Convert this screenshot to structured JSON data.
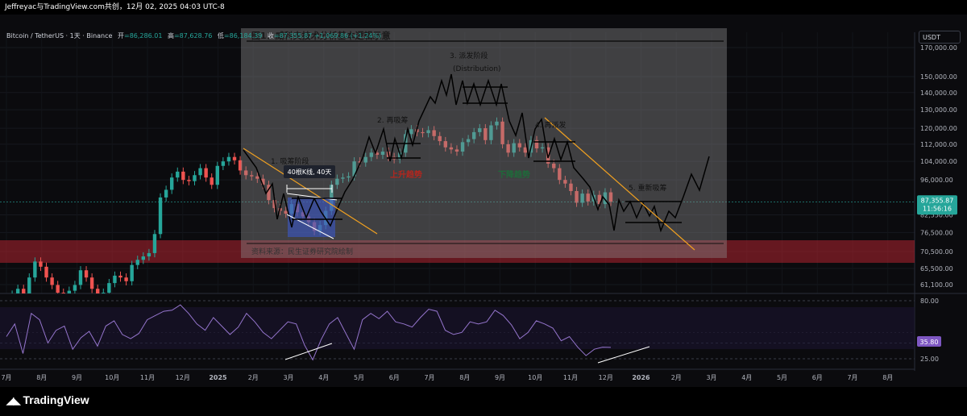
{
  "header": {
    "title": "Jeffreyac与TradingView.com共创，12月 02, 2025 04:03 UTC-8",
    "symbol": "Bitcoin / TetherUS · 1天 · Binance",
    "open_label": "开",
    "open_value": "=86,286.01",
    "high_label": "高",
    "high_value": "=87,628.76",
    "low_label": "低",
    "low_value": "=86,184.39",
    "close_label": "收",
    "close_value": "=87,355.87",
    "change_value": "+1,069.86 (+1.24%)",
    "currency_button": "USDT"
  },
  "price_badge": {
    "price": "87,355.87",
    "countdown": "11:56:16",
    "color": "#26a69a"
  },
  "rsi_badge": {
    "value": "35.80",
    "color": "#7e57c2"
  },
  "overlay": {
    "title": "图1：威科夫技术分析基本逻辑示意",
    "source": "资料来源：民生证券研究院绘制",
    "labels": {
      "phase1": "1. 吸筹阶段",
      "phase2": "2. 再吸筹",
      "phase3": "3. 派发阶段",
      "phase3_en": "(Distribution)",
      "phase4": "4. 再派发",
      "phase5": "5. 重新吸筹",
      "uptrend": "上升趋势",
      "downtrend": "下降趋势",
      "bars_note": "40根K线, 40天"
    }
  },
  "footer": {
    "brand": "TradingView"
  },
  "chart_data": [
    {
      "type": "candlestick",
      "title": "Bitcoin / TetherUS · 1天 · Binance",
      "y_scale": "log",
      "ylim": [
        59500,
        182000
      ],
      "y_ticks": [
        170000,
        150000,
        140000,
        130000,
        120000,
        112000,
        104000,
        96000,
        82550,
        76500,
        70500,
        65500,
        61100
      ],
      "y_tick_labels": [
        "170,000.00",
        "150,000.00",
        "140,000.00",
        "130,000.00",
        "120,000.00",
        "112,000.00",
        "104,000.00",
        "96,000.00",
        "82,550.00",
        "76,500.00",
        "70,500.00",
        "65,500.00",
        "61,100.00"
      ],
      "x_tick_labels": [
        "7月",
        "8月",
        "9月",
        "10月",
        "11月",
        "12月",
        "2025",
        "2月",
        "3月",
        "4月",
        "5月",
        "6月",
        "7月",
        "8月",
        "9月",
        "10月",
        "11月",
        "12月",
        "2026",
        "2月",
        "3月",
        "4月",
        "5月",
        "6月",
        "7月",
        "8月"
      ],
      "last_price": 87355.87,
      "series": [
        {
          "values": [
            57000,
            58500,
            60000,
            58000,
            63000,
            67500,
            66000,
            63000,
            61000,
            59000,
            58500,
            59500,
            61000,
            65000,
            63000,
            60000,
            57500,
            59000,
            61500,
            63500,
            63000,
            62000,
            66500,
            68000,
            69000,
            70000,
            76000,
            89000,
            92000,
            97000,
            99500,
            96000,
            95500,
            98000,
            101000,
            97000,
            94000,
            102000,
            104000,
            106000,
            104500,
            100000,
            98000,
            97500,
            96500,
            94000,
            88000,
            85000,
            84000,
            83000,
            86500,
            83500,
            82000,
            80000,
            77000,
            79000,
            84000,
            94000,
            96500,
            97000,
            97500,
            104000,
            103500,
            106000,
            108000,
            107000,
            108500,
            106000,
            105000,
            108000,
            117000,
            119500,
            118000,
            117500,
            119000,
            116000,
            113500,
            110500,
            109500,
            108500,
            113000,
            114500,
            118000,
            120000,
            114000,
            121500,
            123500,
            112000,
            108000,
            112500,
            110500,
            108000,
            114000,
            110000,
            110500,
            103000,
            101000,
            96000,
            94500,
            91500,
            87000,
            90500,
            87500,
            90000,
            86500,
            91000,
            87355.87
          ]
        }
      ]
    },
    {
      "type": "line",
      "title": "",
      "ylim": [
        18,
        84
      ],
      "y_ticks": [
        80,
        40,
        25
      ],
      "y_tick_labels": [
        "80.00",
        "40.00",
        "25.00"
      ],
      "series": [
        {
          "values": [
            46,
            58,
            30,
            68,
            62,
            40,
            52,
            56,
            34,
            45,
            51,
            37,
            56,
            61,
            48,
            44,
            49,
            62,
            66,
            70,
            71,
            76,
            68,
            58,
            52,
            64,
            56,
            48,
            55,
            68,
            60,
            50,
            44,
            52,
            60,
            58,
            38,
            24,
            43,
            58,
            64,
            49,
            34,
            62,
            68,
            63,
            70,
            60,
            58,
            55,
            64,
            72,
            70,
            52,
            48,
            50,
            60,
            58,
            60,
            71,
            66,
            57,
            44,
            50,
            61,
            58,
            54,
            42,
            46,
            36,
            28,
            34,
            36,
            35.8
          ]
        }
      ]
    }
  ]
}
